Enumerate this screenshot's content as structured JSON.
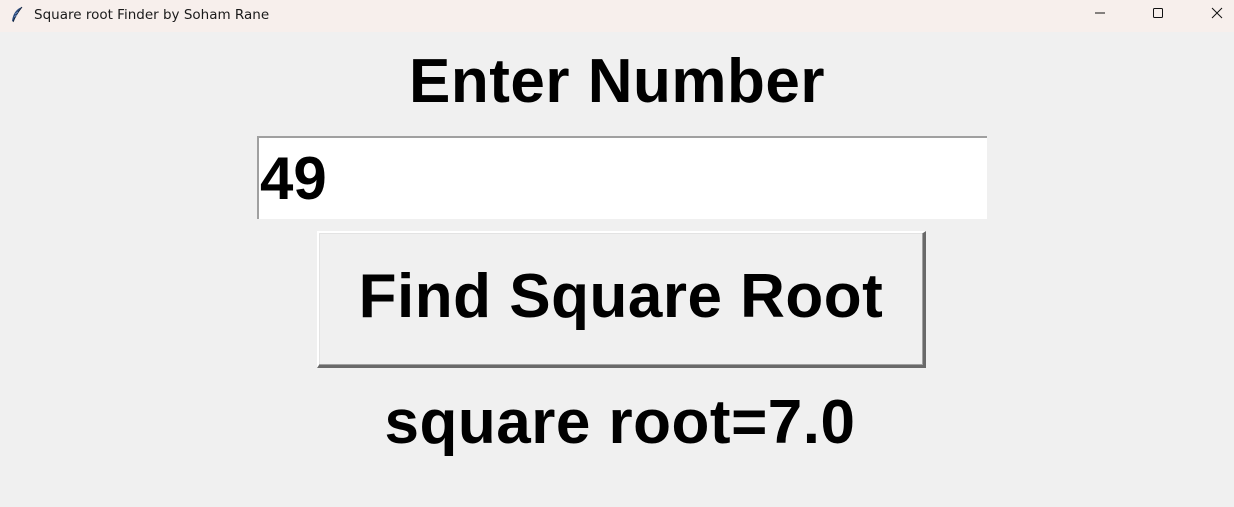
{
  "window": {
    "title": "Square root Finder by Soham Rane",
    "icon": "feather-icon",
    "controls": [
      "minimize-icon",
      "maximize-icon",
      "close-icon"
    ]
  },
  "main": {
    "heading": "Enter Number",
    "input_value": "49",
    "button_label": "Find Square Root",
    "result": "square root=7.0"
  }
}
